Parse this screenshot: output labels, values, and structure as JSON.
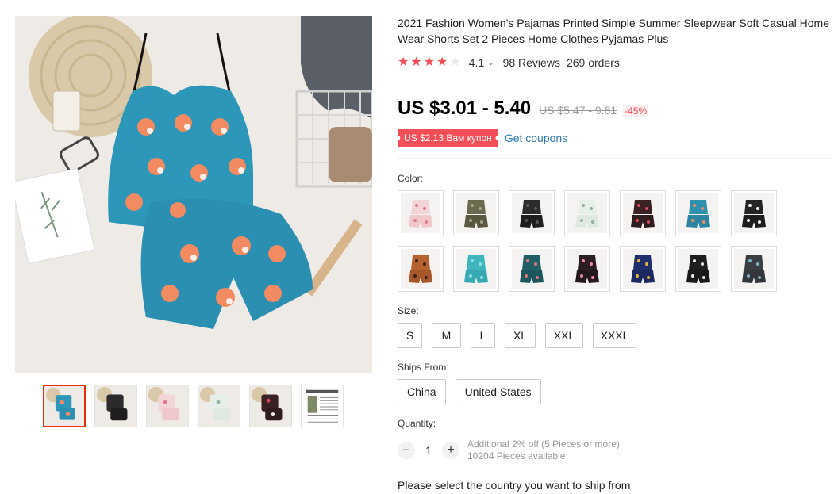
{
  "product": {
    "title": "2021 Fashion Women's Pajamas Printed Simple Summer Sleepwear Soft Casual Home Wear Shorts Set 2 Pieces Home Clothes Pyjamas Plus",
    "rating": "4.1",
    "reviews": "98 Reviews",
    "orders": "269 orders",
    "price": "US $3.01 - 5.40",
    "old_price": "US $5.47 - 9.81",
    "discount": "-45%",
    "coupon": "US $2.13 Вам купон",
    "get_coupons": "Get coupons"
  },
  "gallery": {
    "main_image": "fox-print-pajama-set-photo",
    "thumbnails": [
      {
        "name": "blue-fox-set",
        "active": true
      },
      {
        "name": "black-set",
        "active": false
      },
      {
        "name": "pink-floral-set",
        "active": false
      },
      {
        "name": "white-floral-set",
        "active": false
      },
      {
        "name": "dark-floral-set",
        "active": false
      },
      {
        "name": "size-chart",
        "active": false
      }
    ]
  },
  "color": {
    "label": "Color:",
    "swatches": [
      {
        "name": "pink-floral",
        "top": "#f3d5d8",
        "bottom": "#f0c8cc",
        "accent": "#e07a8a"
      },
      {
        "name": "olive-lace",
        "top": "#6b6a4e",
        "bottom": "#5a5940",
        "accent": "#a9a38a"
      },
      {
        "name": "black",
        "top": "#2b2b2b",
        "bottom": "#1e1e1e",
        "accent": "#555555"
      },
      {
        "name": "white-floral",
        "top": "#e6eee8",
        "bottom": "#dfe9e2",
        "accent": "#8fb39a"
      },
      {
        "name": "dark-red-floral",
        "top": "#3a2224",
        "bottom": "#2f1c1e",
        "accent": "#d8485a"
      },
      {
        "name": "blue-fox",
        "top": "#2e8fae",
        "bottom": "#2a86a4",
        "accent": "#f28a62"
      },
      {
        "name": "black-daisy",
        "top": "#242424",
        "bottom": "#1c1c1c",
        "accent": "#f2f2f2"
      },
      {
        "name": "leopard",
        "top": "#b5622f",
        "bottom": "#a7582a",
        "accent": "#3b2416"
      },
      {
        "name": "teal",
        "top": "#3fb6bf",
        "bottom": "#36a9b2",
        "accent": "#8fe0e4"
      },
      {
        "name": "teal-floral",
        "top": "#1f5f66",
        "bottom": "#1c575e",
        "accent": "#e86f7a"
      },
      {
        "name": "black-pink-floral",
        "top": "#2a1e22",
        "bottom": "#24191c",
        "accent": "#f08aa0"
      },
      {
        "name": "navy-floral",
        "top": "#1f2f6b",
        "bottom": "#1b2a60",
        "accent": "#e8b23e"
      },
      {
        "name": "black-white-floral",
        "top": "#1e1e1e",
        "bottom": "#1a1a1a",
        "accent": "#eaeaea"
      },
      {
        "name": "grey-floral",
        "top": "#3a3d42",
        "bottom": "#33363b",
        "accent": "#7ab0c8"
      }
    ]
  },
  "size": {
    "label": "Size:",
    "options": [
      "S",
      "M",
      "L",
      "XL",
      "XXL",
      "XXXL"
    ]
  },
  "ships_from": {
    "label": "Ships From:",
    "options": [
      "China",
      "United States"
    ]
  },
  "quantity": {
    "label": "Quantity:",
    "value": "1",
    "minus": "−",
    "plus": "+",
    "promo": "Additional 2% off (5 Pieces or more)",
    "available": "10204 Pieces available"
  },
  "ship_message": "Please select the country you want to ship from",
  "colors": {
    "accent_red": "#f44e58",
    "link_blue": "#2e7bb4",
    "active_border": "#e62e04"
  }
}
